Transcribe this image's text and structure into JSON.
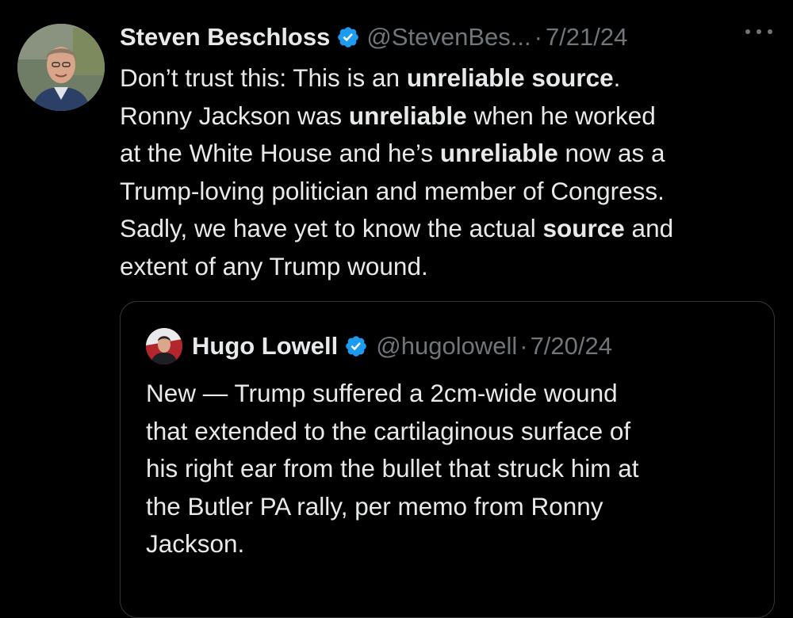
{
  "tweet": {
    "author_name": "Steven Beschloss",
    "handle": "@StevenBes...",
    "separator": "·",
    "date": "7/21/24",
    "verified_icon": "verified-badge-icon",
    "more_icon": "more-options-icon",
    "lines": [
      {
        "parts": [
          "Don’t trust this: This is an ",
          "unreliable source",
          "."
        ]
      },
      {
        "parts": [
          "Ronny Jackson was ",
          "unreliable",
          " when he worked"
        ]
      },
      {
        "parts": [
          "at the White House and he’s ",
          "unreliable",
          " now as a"
        ]
      },
      {
        "parts": [
          "Trump-loving politician and member of Congress.",
          "",
          ""
        ]
      },
      {
        "parts": [
          "Sadly, we have yet to know the actual ",
          "source",
          " and"
        ]
      },
      {
        "parts": [
          "extent of any Trump wound.",
          "",
          ""
        ]
      }
    ]
  },
  "quoted_tweet": {
    "author_name": "Hugo Lowell",
    "handle": "@hugolowell",
    "separator": "·",
    "date": "7/20/24",
    "verified_icon": "verified-badge-icon",
    "lines": [
      "New — Trump suffered a 2cm-wide wound",
      "that extended to the cartilaginous surface of",
      "his right ear from the bullet that struck him at",
      "the Butler PA rally, per memo from Ronny",
      "Jackson."
    ]
  },
  "colors": {
    "background": "#000000",
    "text": "#e7e9ea",
    "secondary": "#71767b",
    "verified": "#1d9bf0",
    "quote_border": "#333639"
  }
}
